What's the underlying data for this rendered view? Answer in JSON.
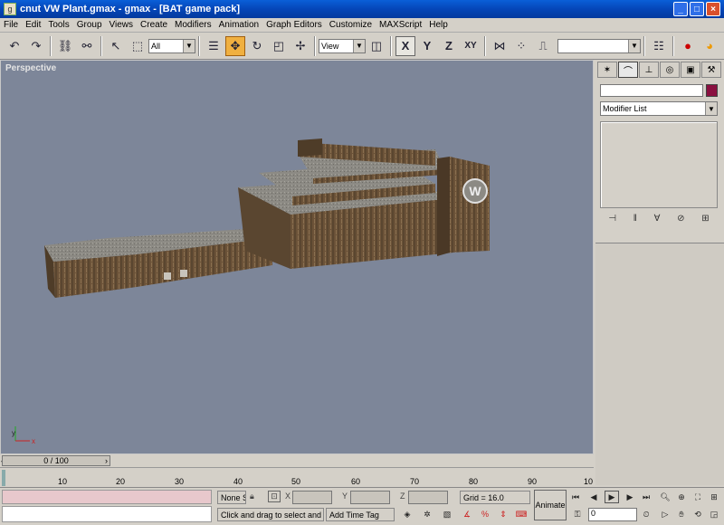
{
  "window": {
    "title": "cnut VW Plant.gmax - gmax - [BAT game pack]",
    "min": "_",
    "max": "□",
    "close": "×"
  },
  "menu": [
    "File",
    "Edit",
    "Tools",
    "Group",
    "Views",
    "Create",
    "Modifiers",
    "Animation",
    "Graph Editors",
    "Customize",
    "MAXScript",
    "Help"
  ],
  "toolbar": {
    "selection_filter": "All",
    "ref_coord": "View",
    "axis_x": "X",
    "axis_y": "Y",
    "axis_z": "Z",
    "axis_xy": "XY",
    "named_selection": ""
  },
  "viewport": {
    "label": "Perspective"
  },
  "command_panel": {
    "modifier_list": "Modifier List"
  },
  "time_slider": {
    "label": "0 / 100"
  },
  "ruler_ticks": [
    "10",
    "20",
    "30",
    "40",
    "50",
    "60",
    "70",
    "80",
    "90",
    "10"
  ],
  "status": {
    "selection": "None S",
    "x_label": "X",
    "y_label": "Y",
    "z_label": "Z",
    "grid": "Grid = 16.0",
    "prompt": "Click and drag to select and m",
    "time_tag": "Add Time Tag",
    "animate": "Animate",
    "frame": "0"
  },
  "colors": {
    "viewport_bg": "#7d8699",
    "accent": "#f0b040",
    "object_color": "#8a1040"
  }
}
